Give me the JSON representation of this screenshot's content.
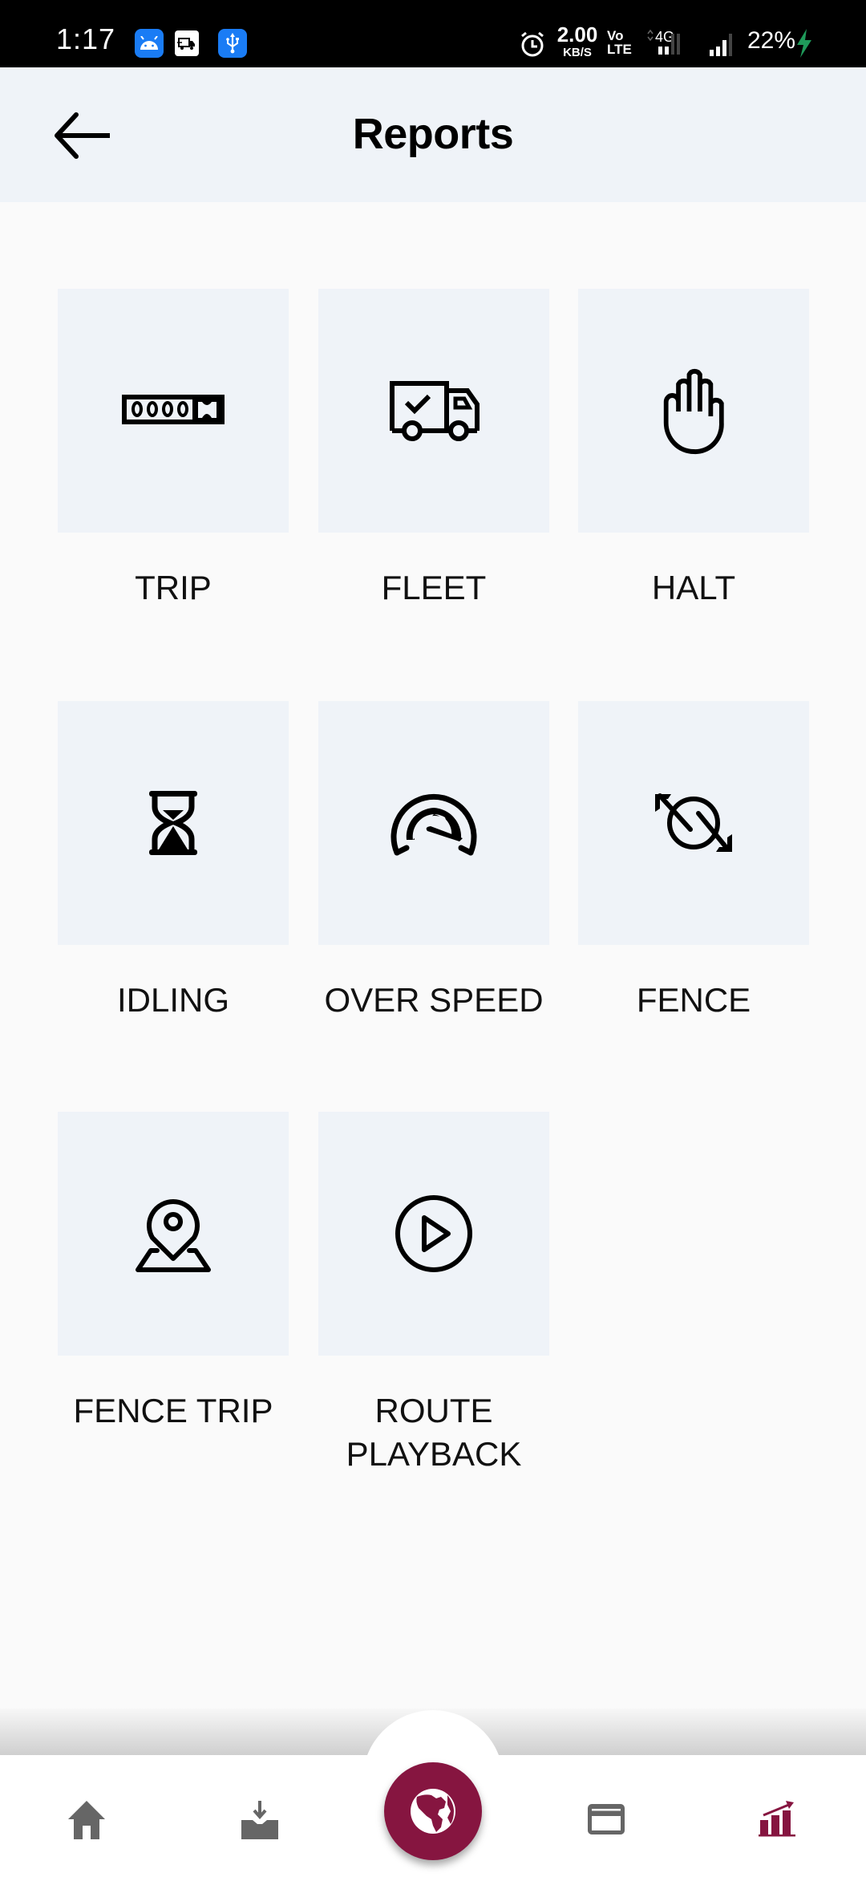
{
  "status_bar": {
    "time": "1:17",
    "notification_icons": [
      "android-icon",
      "truck-app-icon",
      "usb-icon"
    ],
    "network_speed_value": "2.00",
    "network_speed_unit": "KB/S",
    "volte_top": "Vo",
    "volte_bottom": "LTE",
    "network_type": "4G",
    "battery_percent": "22%",
    "charging_color": "#1f9a5a"
  },
  "app_bar": {
    "title": "Reports",
    "back_icon": "arrow-left-icon"
  },
  "reports": [
    {
      "label": "TRIP",
      "icon": "odometer-icon"
    },
    {
      "label": "FLEET",
      "icon": "truck-check-icon"
    },
    {
      "label": "HALT",
      "icon": "hand-stop-icon"
    },
    {
      "label": "IDLING",
      "icon": "hourglass-icon"
    },
    {
      "label": "OVER SPEED",
      "icon": "speedometer-icon"
    },
    {
      "label": "FENCE",
      "icon": "geofence-arrows-icon"
    },
    {
      "label": "FENCE TRIP",
      "icon": "map-pin-area-icon"
    },
    {
      "label": "ROUTE\nPLAYBACK",
      "icon": "play-circle-icon"
    }
  ],
  "bottom_nav": {
    "items": [
      {
        "name": "home",
        "icon": "home-icon",
        "active": false
      },
      {
        "name": "download",
        "icon": "download-tray-icon",
        "active": false
      },
      {
        "name": "map",
        "icon": "globe-icon",
        "active": false,
        "center_fab": true
      },
      {
        "name": "payments",
        "icon": "credit-card-icon",
        "active": false
      },
      {
        "name": "reports",
        "icon": "chart-growth-icon",
        "active": true
      }
    ],
    "accent_color": "#861540",
    "inactive_color": "#666666"
  }
}
